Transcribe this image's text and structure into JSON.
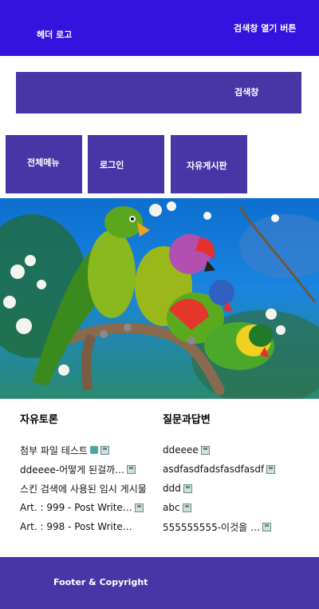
{
  "header": {
    "logo": "헤더 로고",
    "search_toggle": "검색창 열기 버튼"
  },
  "search": {
    "label": "검색창"
  },
  "nav": {
    "items": [
      {
        "label": "전체메뉴"
      },
      {
        "label": "로그인"
      },
      {
        "label": "자유게시판"
      }
    ]
  },
  "boards": {
    "free": {
      "title": "자유토론",
      "rows": [
        {
          "text": "첨부 파일 테스트",
          "icons": [
            "attach-icon",
            "save-icon"
          ]
        },
        {
          "text": "ddeeee-어떻게 된걸까…",
          "icons": [
            "save-icon"
          ]
        },
        {
          "text": "스킨 검색에 사용된 임시 게시물",
          "icons": []
        },
        {
          "text": "Art. : 999 - Post Write…",
          "icons": [
            "save-icon"
          ]
        },
        {
          "text": "Art. : 998 - Post Write…",
          "icons": []
        }
      ]
    },
    "qna": {
      "title": "질문과답변",
      "rows": [
        {
          "text": "ddeeee",
          "icons": [
            "save-icon"
          ]
        },
        {
          "text": "asdfasdfadsfasdfasdf",
          "icons": [
            "save-icon"
          ]
        },
        {
          "text": "ddd",
          "icons": [
            "save-icon"
          ]
        },
        {
          "text": "abc",
          "icons": [
            "save-icon"
          ]
        },
        {
          "text": "555555555-이것을 …",
          "icons": [
            "save-icon"
          ]
        }
      ]
    }
  },
  "footer": {
    "text": "Footer & Copyright"
  },
  "colors": {
    "header_bg": "#3413de",
    "block_bg": "#4836a6",
    "text_light": "#ffffff"
  }
}
